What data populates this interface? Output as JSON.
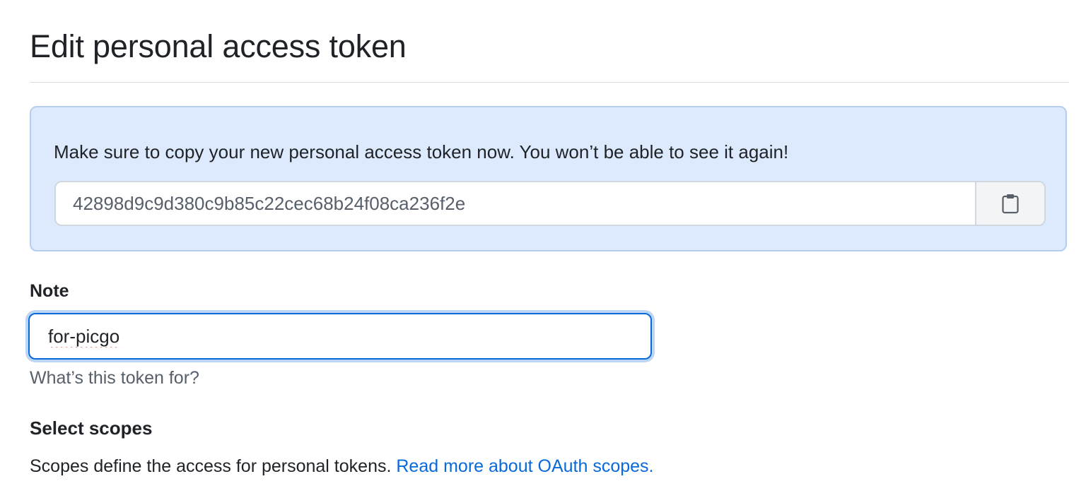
{
  "page": {
    "title": "Edit personal access token"
  },
  "flash": {
    "message": "Make sure to copy your new personal access token now. You won’t be able to see it again!",
    "token": "42898d9c9d380c9b85c22cec68b24f08ca236f2e",
    "copy_icon": "clipboard-icon"
  },
  "note": {
    "label": "Note",
    "value": "for-picgo",
    "hint": "What’s this token for?"
  },
  "scopes": {
    "heading": "Select scopes",
    "description": "Scopes define the access for personal tokens.",
    "link_text": "Read more about OAuth scopes."
  },
  "colors": {
    "flash_background": "#ddeafd",
    "flash_border": "#b6cdec",
    "focus_ring": "#0969da",
    "link": "#0969da",
    "muted_text": "#57606a"
  }
}
